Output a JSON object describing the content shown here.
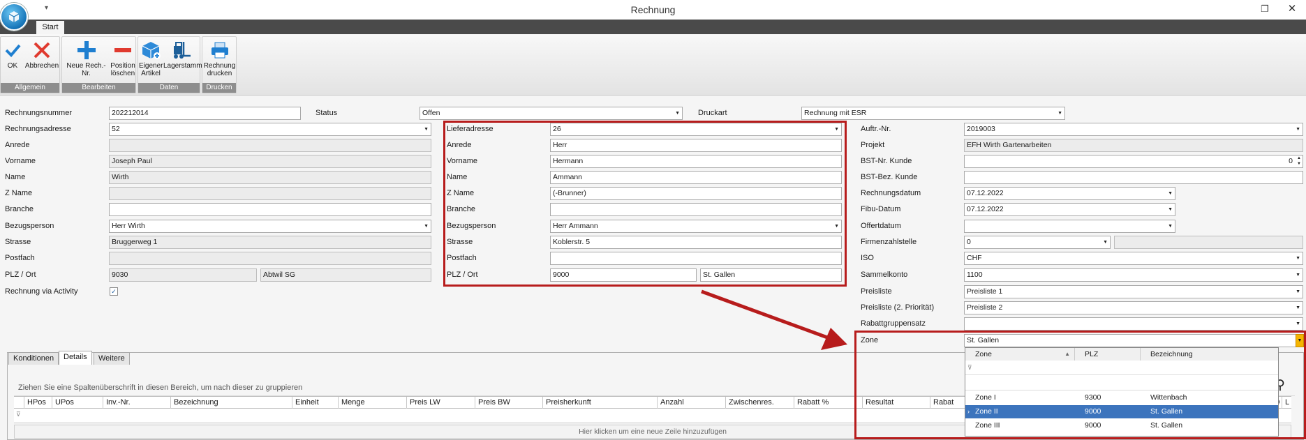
{
  "window": {
    "title": "Rechnung",
    "quick_access": "▾",
    "maximize": "❐",
    "close": "✕"
  },
  "ribbon": {
    "tab": "Start",
    "groups": [
      {
        "caption": "Allgemein",
        "buttons": [
          {
            "label": "OK"
          },
          {
            "label": "Abbrechen"
          }
        ]
      },
      {
        "caption": "Bearbeiten",
        "buttons": [
          {
            "label": "Neue Rech.-Nr."
          },
          {
            "label": "Position\nlöschen"
          }
        ]
      },
      {
        "caption": "Daten",
        "buttons": [
          {
            "label": "Eigener\nArtikel"
          },
          {
            "label": "Lagerstamm"
          }
        ]
      },
      {
        "caption": "Drucken",
        "buttons": [
          {
            "label": "Rechnung\ndrucken"
          }
        ]
      }
    ]
  },
  "header": {
    "rechnungsnummer": {
      "label": "Rechnungsnummer",
      "value": "202212014"
    },
    "status": {
      "label": "Status",
      "value": "Offen"
    },
    "druckart": {
      "label": "Druckart",
      "value": "Rechnung mit ESR"
    }
  },
  "rechnungsadresse": {
    "adresse": {
      "label": "Rechnungsadresse",
      "value": "52"
    },
    "anrede": {
      "label": "Anrede",
      "value": ""
    },
    "vorname": {
      "label": "Vorname",
      "value": "Joseph Paul"
    },
    "name": {
      "label": "Name",
      "value": "Wirth"
    },
    "zname": {
      "label": "Z Name",
      "value": ""
    },
    "branche": {
      "label": "Branche",
      "value": ""
    },
    "bezugsperson": {
      "label": "Bezugsperson",
      "value": "Herr Wirth"
    },
    "strasse": {
      "label": "Strasse",
      "value": "Bruggerweg 1"
    },
    "postfach": {
      "label": "Postfach",
      "value": ""
    },
    "plz": {
      "label": "PLZ / Ort",
      "value": "9030",
      "ort": "Abtwil SG"
    },
    "activity": {
      "label": "Rechnung via Activity",
      "checked": "✓"
    }
  },
  "lieferadresse": {
    "adresse": {
      "label": "Lieferadresse",
      "value": "26"
    },
    "anrede": {
      "label": "Anrede",
      "value": "Herr"
    },
    "vorname": {
      "label": "Vorname",
      "value": "Hermann"
    },
    "name": {
      "label": "Name",
      "value": "Ammann"
    },
    "zname": {
      "label": "Z Name",
      "value": "(-Brunner)"
    },
    "branche": {
      "label": "Branche",
      "value": ""
    },
    "bezugsperson": {
      "label": "Bezugsperson",
      "value": "Herr Ammann"
    },
    "strasse": {
      "label": "Strasse",
      "value": "Koblerstr. 5"
    },
    "postfach": {
      "label": "Postfach",
      "value": ""
    },
    "plz": {
      "label": "PLZ / Ort",
      "value": "9000",
      "ort": "St. Gallen"
    }
  },
  "details": {
    "auftr": {
      "label": "Auftr.-Nr.",
      "value": "2019003"
    },
    "projekt": {
      "label": "Projekt",
      "value": "EFH Wirth Gartenarbeiten"
    },
    "bst_nr": {
      "label": "BST-Nr. Kunde",
      "value": "0"
    },
    "bst_bez": {
      "label": "BST-Bez. Kunde",
      "value": ""
    },
    "rechnungsdatum": {
      "label": "Rechnungsdatum",
      "value": "07.12.2022"
    },
    "fibu": {
      "label": "Fibu-Datum",
      "value": "07.12.2022"
    },
    "offert": {
      "label": "Offertdatum",
      "value": ""
    },
    "firmenzahlstelle": {
      "label": "Firmenzahlstelle",
      "value": "0"
    },
    "iso": {
      "label": "ISO",
      "value": "CHF"
    },
    "sammelkonto": {
      "label": "Sammelkonto",
      "value": "1100"
    },
    "preisliste": {
      "label": "Preisliste",
      "value": "Preisliste 1"
    },
    "preisliste2": {
      "label": "Preisliste (2. Priorität)",
      "value": "Preisliste 2"
    },
    "rabattgruppe": {
      "label": "Rabattgruppensatz",
      "value": ""
    },
    "zone": {
      "label": "Zone",
      "value": "St. Gallen"
    }
  },
  "zone_popup": {
    "headers": [
      "Zone",
      "PLZ",
      "Bezeichnung"
    ],
    "rows": [
      {
        "zone": "Zone I",
        "plz": "9300",
        "bez": "Wittenbach"
      },
      {
        "zone": "Zone II",
        "plz": "9000",
        "bez": "St. Gallen"
      },
      {
        "zone": "Zone III",
        "plz": "9000",
        "bez": "St. Gallen"
      }
    ]
  },
  "tabs": [
    "Konditionen",
    "Details",
    "Weitere"
  ],
  "grid": {
    "group_hint": "Ziehen Sie eine Spaltenüberschrift in diesen Bereich, um nach dieser zu gruppieren",
    "columns": [
      "HPos",
      "UPos",
      "Inv.-Nr.",
      "Bezeichnung",
      "Einheit",
      "Menge",
      "Preis LW",
      "Preis BW",
      "Preisherkunft",
      "Anzahl",
      "Zwischenres.",
      "Rabatt %",
      "Resultat",
      "Rabat",
      "O",
      "L"
    ],
    "new_row": "Hier klicken um eine neue Zeile hinzuzufügen"
  },
  "colors": {
    "highlight": "#b71c1c",
    "selected_row": "#3c74bd",
    "caption_bar": "#8e8e8e"
  }
}
